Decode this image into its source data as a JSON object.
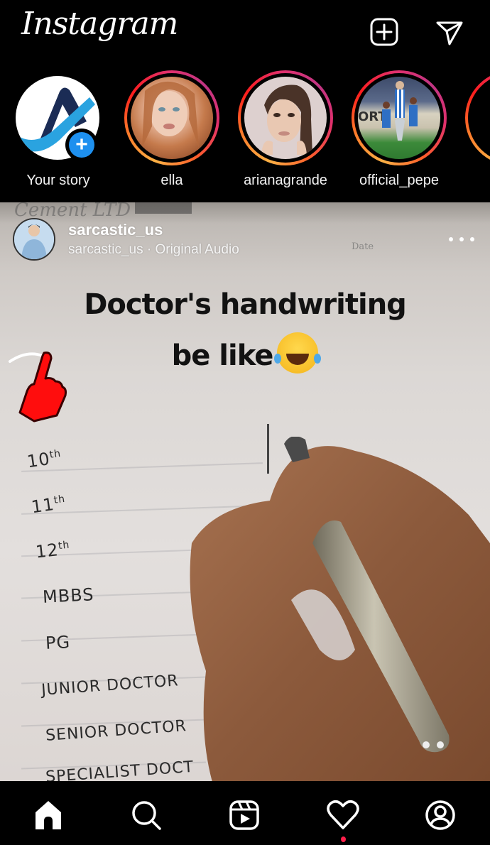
{
  "app": {
    "title": "Instagram"
  },
  "header": {
    "logo_text": "Instagram",
    "new_post_icon": "plus-square-icon",
    "direct_icon": "paper-plane-icon"
  },
  "stories": [
    {
      "label": "Your story",
      "own": true,
      "badge_icon": "plus-icon"
    },
    {
      "label": "ella",
      "own": false
    },
    {
      "label": "arianagrande",
      "own": false
    },
    {
      "label": "official_pepe",
      "own": false
    },
    {
      "label": "",
      "own": false
    }
  ],
  "post": {
    "username": "sarcastic_us",
    "audio": "sarcastic_us · Original Audio",
    "more_icon": "more-horizontal-icon",
    "caption_line1": "Doctor's handwriting",
    "caption_line2": "be like",
    "caption_emoji": "face-with-tears-of-joy",
    "background_brand": "Cement LTD",
    "date_label": "Date",
    "handwritten_list": [
      {
        "text": "10",
        "sup": "th"
      },
      {
        "text": "11",
        "sup": "th"
      },
      {
        "text": "12",
        "sup": "th"
      },
      {
        "text": "MBBS",
        "sup": ""
      },
      {
        "text": "PG",
        "sup": ""
      },
      {
        "text": "JUNIOR DOCTOR",
        "sup": ""
      },
      {
        "text": "SENIOR DOCTOR",
        "sup": ""
      },
      {
        "text": "SPECIALIST DOCT",
        "sup": ""
      }
    ]
  },
  "bottom_nav": [
    {
      "name": "home",
      "icon": "home-icon",
      "active": true
    },
    {
      "name": "search",
      "icon": "search-icon",
      "active": false
    },
    {
      "name": "reels",
      "icon": "reels-icon",
      "active": false
    },
    {
      "name": "activity",
      "icon": "heart-icon",
      "active": false,
      "notification": true
    },
    {
      "name": "profile",
      "icon": "profile-icon",
      "active": false
    }
  ],
  "colors": {
    "background": "#000000",
    "story_ring_start": "#fcb045",
    "story_ring_end": "#c13584",
    "add_story_badge": "#1e90ef",
    "notification_dot": "#ff1f4b"
  }
}
